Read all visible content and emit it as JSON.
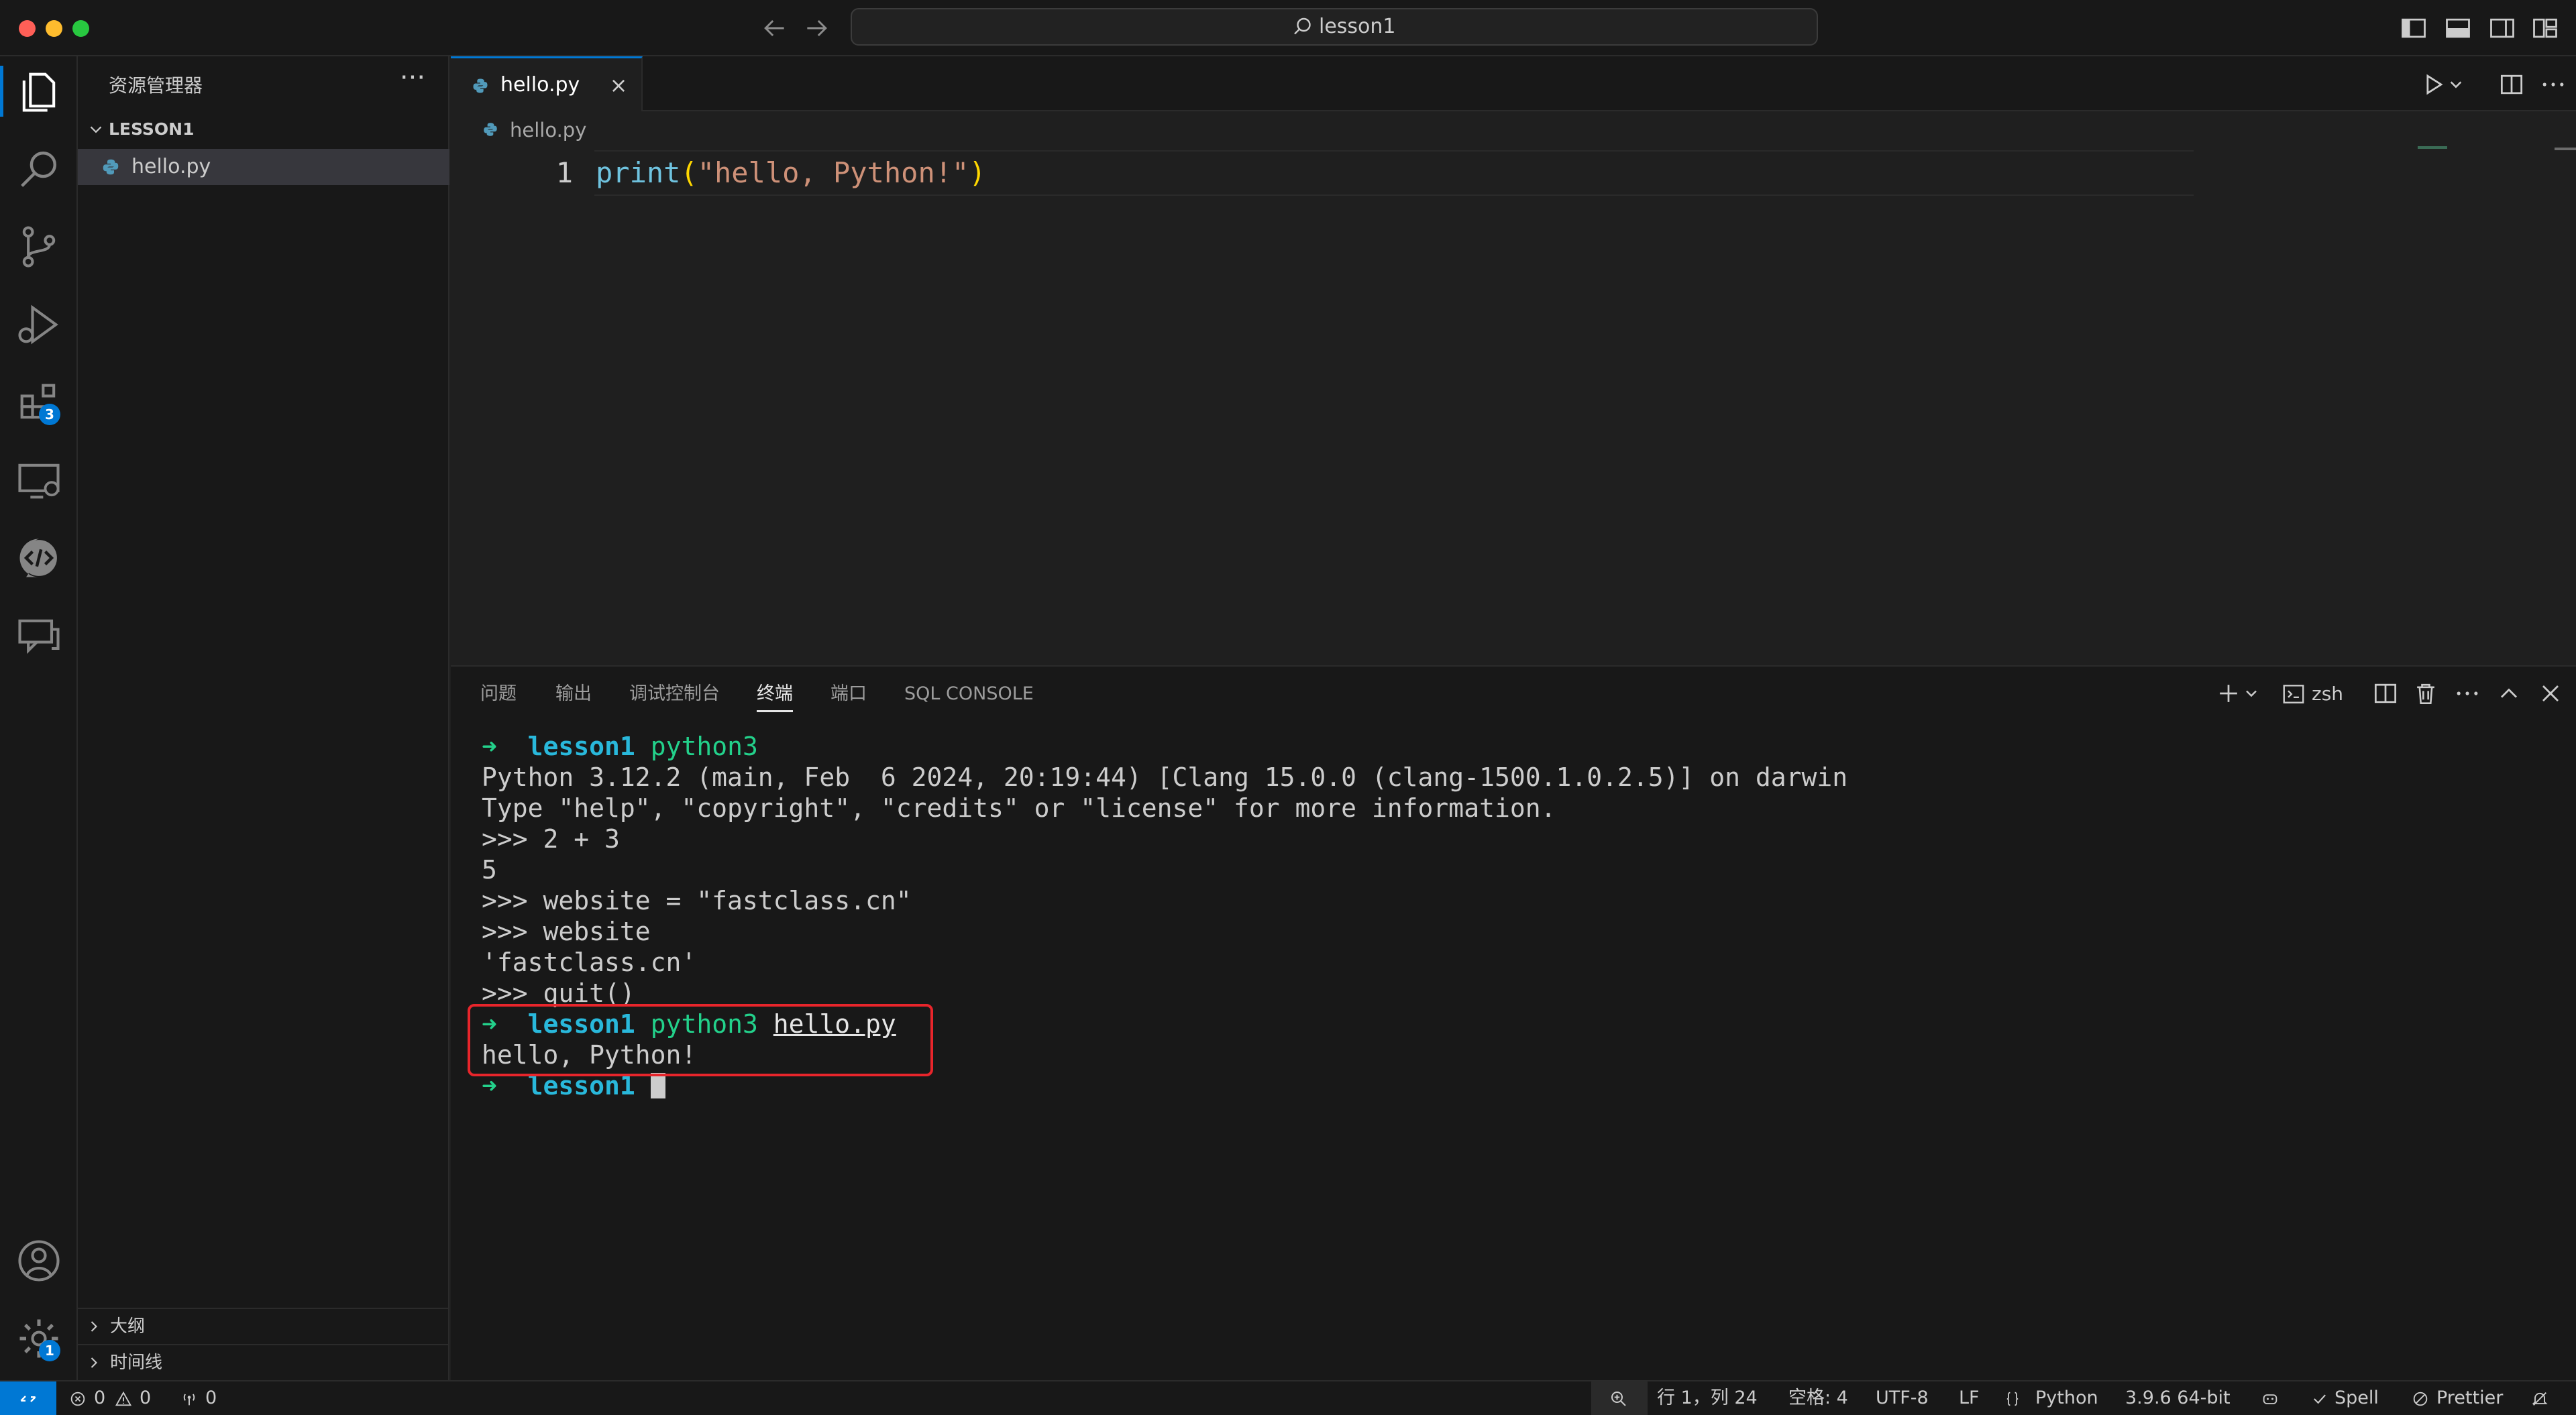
{
  "titlebar": {
    "search_text": "lesson1"
  },
  "activitybar": {
    "extensions_badge": "3",
    "manage_badge": "1"
  },
  "sidebar": {
    "title": "资源管理器",
    "more": "···",
    "folder": "LESSON1",
    "file": "hello.py",
    "outline": "大纲",
    "timeline": "时间线"
  },
  "editor": {
    "tab_label": "hello.py",
    "tab_close": "×",
    "breadcrumb": "hello.py",
    "line_number": "1",
    "code": {
      "fn": "print",
      "open": "(",
      "str": "\"hello, Python!\"",
      "close": ")"
    }
  },
  "panel": {
    "tabs": [
      "问题",
      "输出",
      "调试控制台",
      "终端",
      "端口",
      "SQL CONSOLE"
    ],
    "active_tab": "终端",
    "terminal_name": "zsh"
  },
  "terminal": {
    "arrow": "➜",
    "dir": "lesson1",
    "cmd1": "python3",
    "banner": "Python 3.12.2 (main, Feb  6 2024, 20:19:44) [Clang 15.0.0 (clang-1500.1.0.2.5)] on darwin",
    "hint": "Type \"help\", \"copyright\", \"credits\" or \"license\" for more information.",
    "l1": ">>> 2 + 3",
    "l2": "5",
    "l3": ">>> website = \"fastclass.cn\"",
    "l4": ">>> website",
    "l5": "'fastclass.cn'",
    "l6": ">>> quit()",
    "cmd2": "python3",
    "cmd2_file": "hello.py",
    "output": "hello, Python!"
  },
  "statusbar": {
    "errors": "0",
    "warnings": "0",
    "ports": "0",
    "position": "行 1，列 24",
    "spaces": "空格: 4",
    "encoding": "UTF-8",
    "eol": "LF",
    "language": "Python",
    "interpreter": "3.9.6 64-bit",
    "spell": "Spell",
    "prettier": "Prettier"
  },
  "colors": {
    "accent": "#0078d4",
    "highlight_box": "#e8252b",
    "prompt_arrow": "#23d18b",
    "prompt_dir": "#29b8db"
  }
}
